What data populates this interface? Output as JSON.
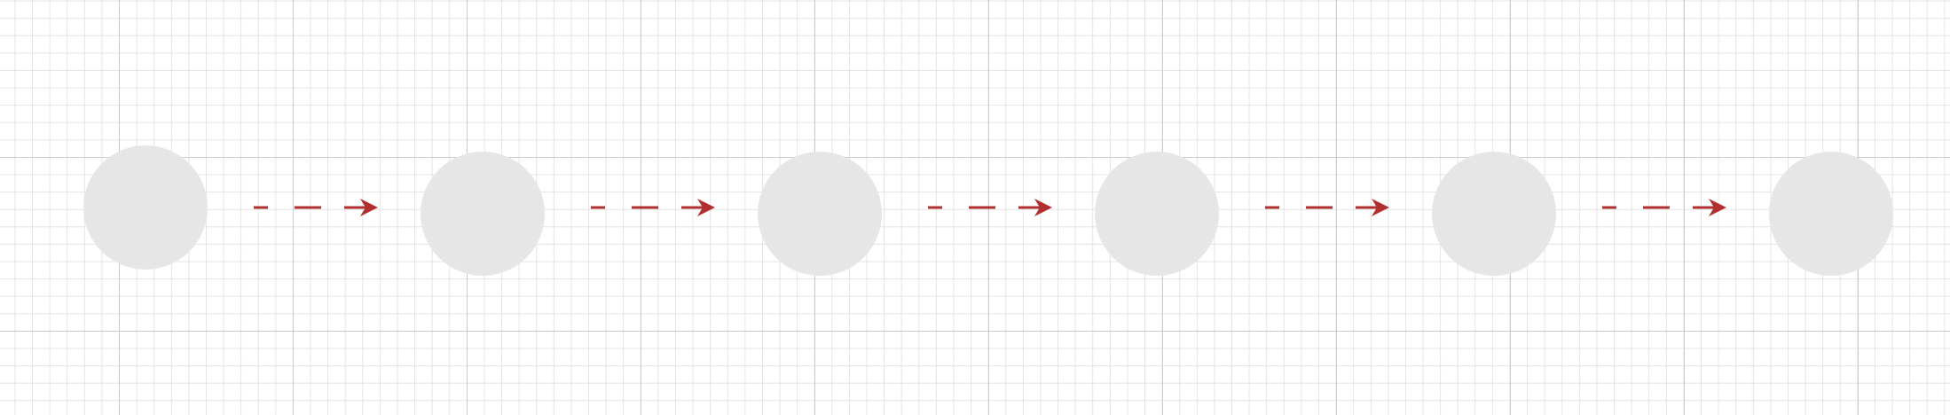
{
  "diagram": {
    "node_count": 6,
    "node_fill": "#e6e6e6",
    "edge_color": "#b03030",
    "edge_style": "dashed",
    "edge_count": 5,
    "grid_color_major": "#c8c8c8",
    "grid_color_minor": "#e1e1e1"
  }
}
